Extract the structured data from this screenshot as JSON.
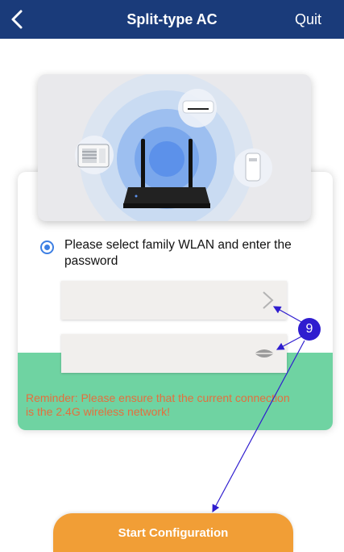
{
  "header": {
    "title": "Split-type AC",
    "quit_label": "Quit",
    "back_icon": "chevron-left-icon"
  },
  "illustration": {
    "icons": [
      "window-ac-icon",
      "wall-ac-icon",
      "router-icon",
      "portable-ac-icon"
    ]
  },
  "wifi_step": {
    "instruction": "Please select family WLAN and enter the password",
    "radio_selected": true,
    "wlan_field": {
      "value": "",
      "icon": "chevron-right-icon"
    },
    "password_field": {
      "value": "",
      "placeholder": "",
      "icon": "eye-icon"
    },
    "reminder": "Reminder: Please ensure that the current connection is the 2.4G wireless network!"
  },
  "annotation": {
    "badge": "9"
  },
  "footer": {
    "start_label": "Start Configuration"
  },
  "colors": {
    "header_bg": "#1a3b7a",
    "accent_blue": "#3d7fe3",
    "reminder_bg": "#6fd3a2",
    "reminder_text": "#e46f3d",
    "start_button": "#f19e36",
    "annotation": "#2f1dcf"
  }
}
